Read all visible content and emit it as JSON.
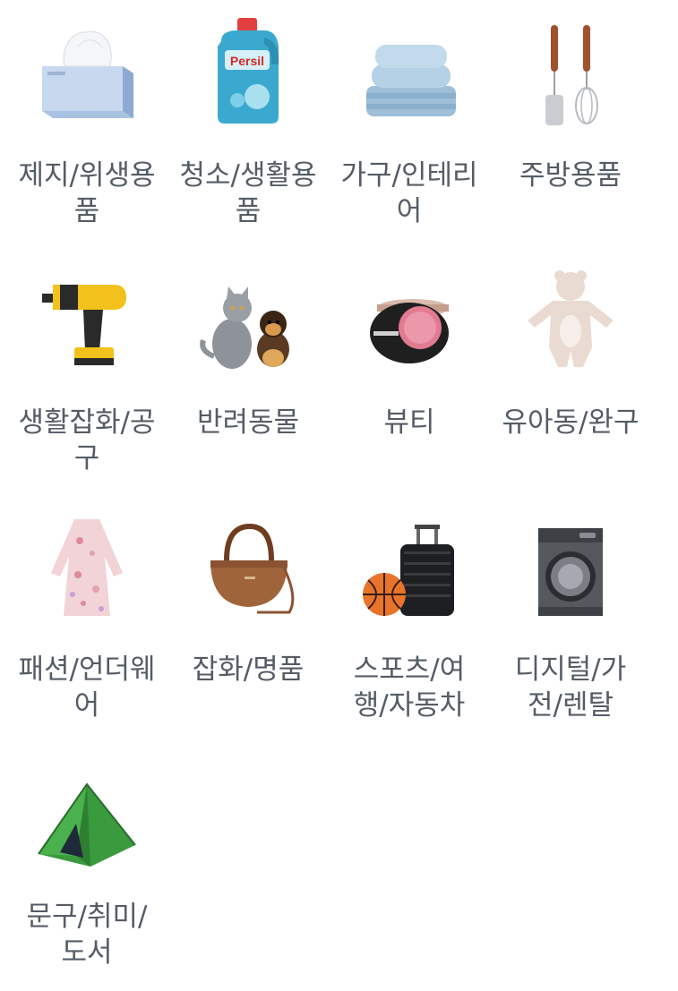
{
  "categories": [
    {
      "label": "제지/위생용품",
      "icon": "tissue-box-icon"
    },
    {
      "label": "청소/생활용품",
      "icon": "detergent-bottle-icon"
    },
    {
      "label": "가구/인테리어",
      "icon": "pillows-bedding-icon"
    },
    {
      "label": "주방용품",
      "icon": "kitchen-utensils-icon"
    },
    {
      "label": "생활잡화/공구",
      "icon": "power-drill-icon"
    },
    {
      "label": "반려동물",
      "icon": "cat-and-dog-icon"
    },
    {
      "label": "뷰티",
      "icon": "cushion-compact-icon"
    },
    {
      "label": "유아동/완구",
      "icon": "baby-romper-icon"
    },
    {
      "label": "패션/언더웨어",
      "icon": "floral-dress-icon"
    },
    {
      "label": "잡화/명품",
      "icon": "handbag-icon"
    },
    {
      "label": "스포츠/여행/자동차",
      "icon": "suitcase-basketball-icon"
    },
    {
      "label": "디지털/가전/렌탈",
      "icon": "washing-machine-icon"
    },
    {
      "label": "문구/취미/도서",
      "icon": "camping-tent-icon"
    }
  ],
  "product_text": {
    "persil_brand": "Persil"
  }
}
